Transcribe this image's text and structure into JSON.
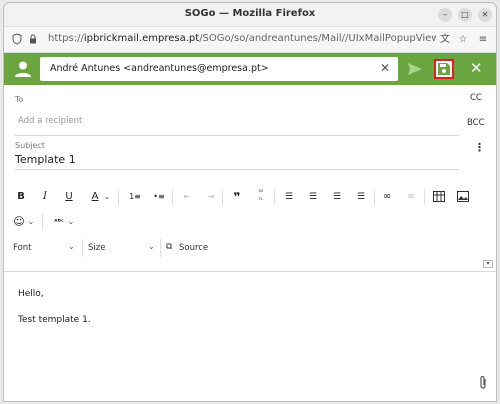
{
  "window": {
    "title": "SOGo — Mozilla Firefox"
  },
  "urlbar": {
    "url_prefix": "https://",
    "url_domain": "ipbrickmail.empresa.pt",
    "url_path": "/SOGo/so/andreantunes/Mail//UIxMailPopupView#!/Ma"
  },
  "toolbar": {
    "from": "André Antunes <andreantunes@empresa.pt>"
  },
  "recipients": {
    "to_label": "To",
    "placeholder": "Add a recipient",
    "cc_label": "CC",
    "bcc_label": "BCC"
  },
  "subject": {
    "label": "Subject",
    "value": "Template 1"
  },
  "editor": {
    "font_label": "Font",
    "size_label": "Size",
    "source_label": "Source"
  },
  "body": {
    "line1": "Hello,",
    "line2": "Test template 1."
  },
  "colors": {
    "toolbar": "#6ba540",
    "save_highlight": "#e02020"
  }
}
